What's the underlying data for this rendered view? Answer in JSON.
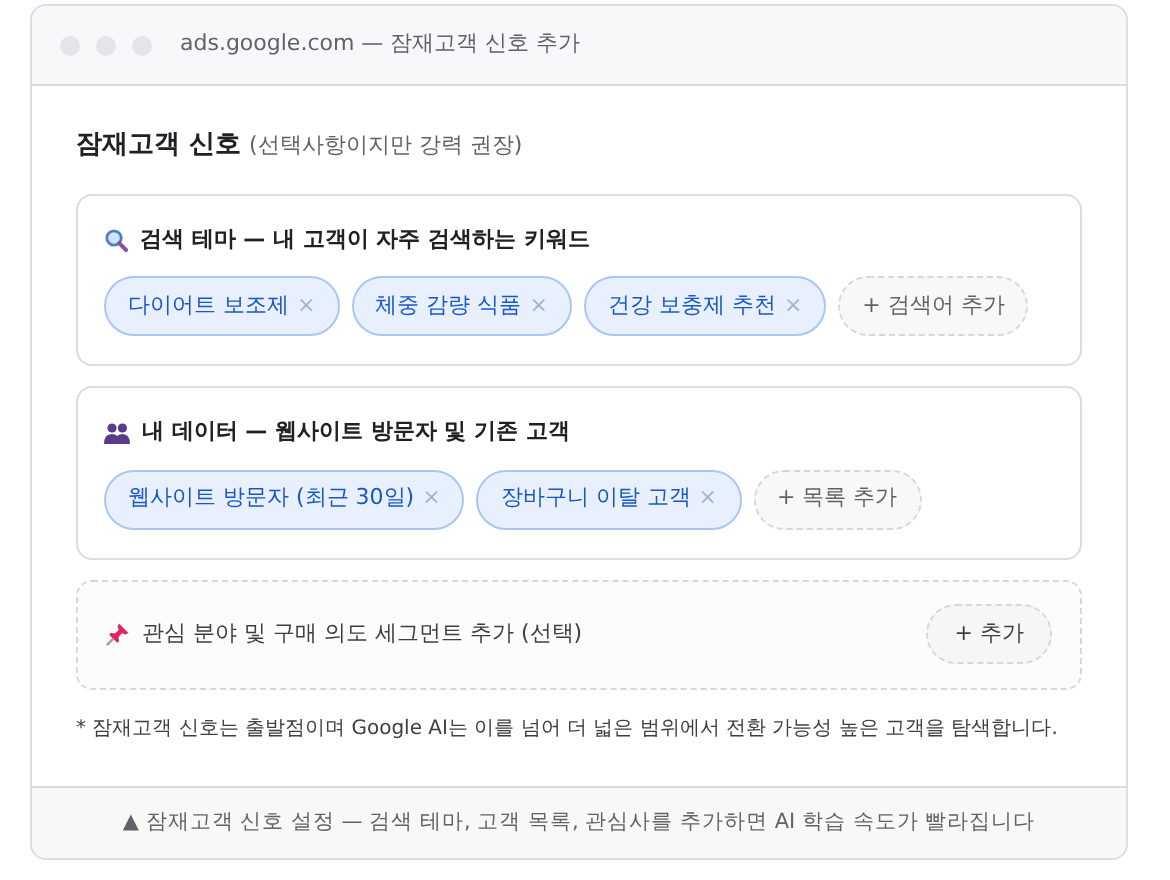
{
  "window": {
    "title": "ads.google.com — 잠재고객 신호 추가"
  },
  "heading": {
    "title": "잠재고객 신호",
    "note": "(선택사항이지만 강력 권장)"
  },
  "sections": [
    {
      "kind": "search",
      "title": "검색 테마 — 내 고객이 자주 검색하는 키워드",
      "chips": [
        {
          "label": "다이어트 보조제",
          "remove": "×"
        },
        {
          "label": "체중 감량 식품",
          "remove": "×"
        },
        {
          "label": "건강 보충제 추천",
          "remove": "×"
        }
      ],
      "add": "+ 검색어 추가"
    },
    {
      "kind": "data",
      "title": "내 데이터 — 웹사이트 방문자 및 기존 고객",
      "chips": [
        {
          "label": "웹사이트 방문자 (최근 30일)",
          "remove": "×"
        },
        {
          "label": "장바구니 이탈 고객",
          "remove": "×"
        }
      ],
      "add": "+ 목록 추가"
    },
    {
      "kind": "interest",
      "title": "관심 분야 및 구매 의도 세그먼트 추가 (선택)",
      "add": "+ 추가"
    }
  ],
  "footnote": "* 잠재고객 신호는 출발점이며 Google AI는 이를 넘어 더 넓은 범위에서 전환 가능성 높은 고객을 탐색합니다.",
  "status_bar": "▲ 잠재고객 신호 설정 — 검색 테마, 고객 목록, 관심사를 추가하면 AI 학습 속도가 빨라집니다"
}
